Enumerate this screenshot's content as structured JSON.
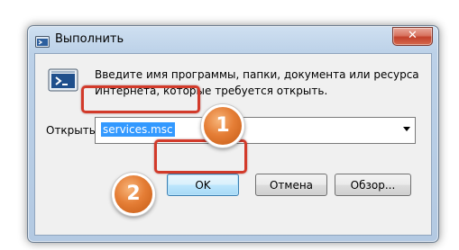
{
  "window": {
    "title": "Выполнить",
    "close_label": "✕"
  },
  "dialog": {
    "description": "Введите имя программы, папки, документа или ресурса Интернета, которые требуется открыть.",
    "open_label": "Открыть:",
    "open_value": "services.msc"
  },
  "buttons": {
    "ok": "OK",
    "cancel": "Отмена",
    "browse": "Обзор..."
  },
  "annotations": {
    "step1": "1",
    "step2": "2"
  },
  "colors": {
    "highlight": "#d23a2a",
    "step_badge": "#e57e36",
    "selection": "#3399ff"
  },
  "icons": {
    "title": "run-icon",
    "dialog": "run-program-icon",
    "dropdown": "chevron-down-icon"
  }
}
